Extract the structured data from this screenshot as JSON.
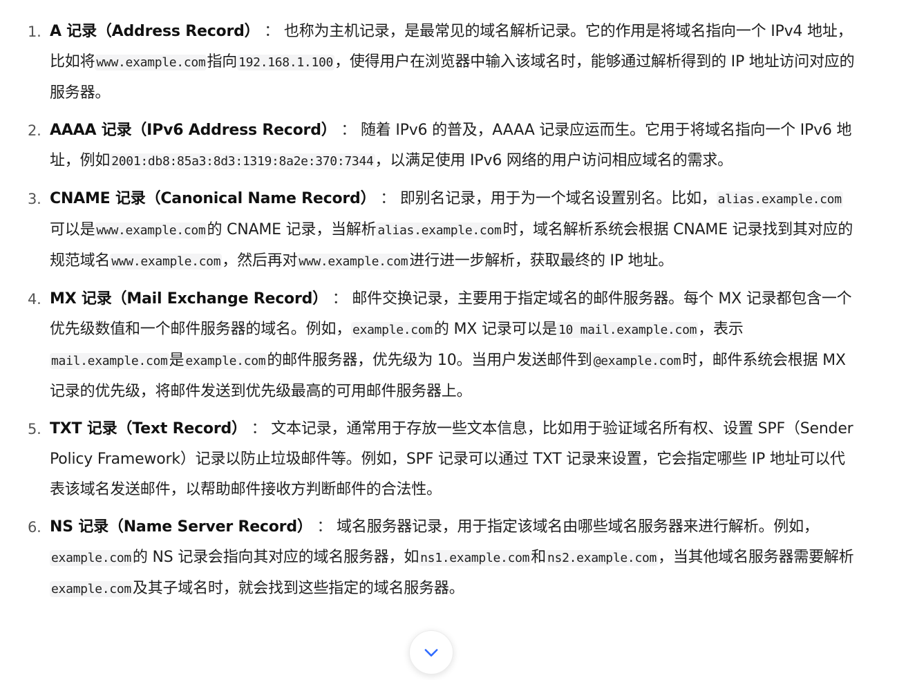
{
  "items": [
    {
      "number": "1.",
      "term": "A 记录（Address Record）",
      "colon": "：",
      "segments": [
        {
          "type": "text",
          "text": "也称为主机记录，是最常见的域名解析记录。它的作用是将域名指向一个 IPv4 地址，比如将"
        },
        {
          "type": "code",
          "text": "www.example.com"
        },
        {
          "type": "text",
          "text": "指向"
        },
        {
          "type": "code",
          "text": "192.168.1.100"
        },
        {
          "type": "text",
          "text": "，使得用户在浏览器中输入该域名时，能够通过解析得到的 IP 地址访问对应的服务器。"
        }
      ]
    },
    {
      "number": "2.",
      "term": "AAAA 记录（IPv6 Address Record）",
      "colon": "：",
      "segments": [
        {
          "type": "text",
          "text": "随着 IPv6 的普及，AAAA 记录应运而生。它用于将域名指向一个 IPv6 地址，例如"
        },
        {
          "type": "code",
          "text": "2001:db8:85a3:8d3:1319:8a2e:370:7344"
        },
        {
          "type": "text",
          "text": "，以满足使用 IPv6 网络的用户访问相应域名的需求。"
        }
      ]
    },
    {
      "number": "3.",
      "term": "CNAME 记录（Canonical Name Record）",
      "colon": "：",
      "segments": [
        {
          "type": "text",
          "text": "即别名记录，用于为一个域名设置别名。比如，"
        },
        {
          "type": "code",
          "text": "alias.example.com"
        },
        {
          "type": "text",
          "text": "可以是"
        },
        {
          "type": "code",
          "text": "www.example.com"
        },
        {
          "type": "text",
          "text": "的 CNAME 记录，当解析"
        },
        {
          "type": "code",
          "text": "alias.example.com"
        },
        {
          "type": "text",
          "text": "时，域名解析系统会根据 CNAME 记录找到其对应的规范域名"
        },
        {
          "type": "code",
          "text": "www.example.com"
        },
        {
          "type": "text",
          "text": "，然后再对"
        },
        {
          "type": "code",
          "text": "www.example.com"
        },
        {
          "type": "text",
          "text": "进行进一步解析，获取最终的 IP 地址。"
        }
      ]
    },
    {
      "number": "4.",
      "term": "MX 记录（Mail Exchange Record）",
      "colon": "：",
      "segments": [
        {
          "type": "text",
          "text": "邮件交换记录，主要用于指定域名的邮件服务器。每个 MX 记录都包含一个优先级数值和一个邮件服务器的域名。例如，"
        },
        {
          "type": "code",
          "text": "example.com"
        },
        {
          "type": "text",
          "text": "的 MX 记录可以是"
        },
        {
          "type": "code",
          "text": "10 mail.example.com"
        },
        {
          "type": "text",
          "text": "，表示"
        },
        {
          "type": "code",
          "text": "mail.example.com"
        },
        {
          "type": "text",
          "text": "是"
        },
        {
          "type": "code",
          "text": "example.com"
        },
        {
          "type": "text",
          "text": "的邮件服务器，优先级为 10。当用户发送邮件到"
        },
        {
          "type": "code",
          "text": "@example.com"
        },
        {
          "type": "text",
          "text": "时，邮件系统会根据 MX 记录的优先级，将邮件发送到优先级最高的可用邮件服务器上。"
        }
      ]
    },
    {
      "number": "5.",
      "term": "TXT 记录（Text Record）",
      "colon": "：",
      "segments": [
        {
          "type": "text",
          "text": "文本记录，通常用于存放一些文本信息，比如用于验证域名所有权、设置 SPF（Sender Policy Framework）记录以防止垃圾邮件等。例如，SPF 记录可以通过 TXT 记录来设置，它会指定哪些 IP 地址可以代表该域名发送邮件，以帮助邮件接收方判断邮件的合法性。"
        }
      ]
    },
    {
      "number": "6.",
      "term": "NS 记录（Name Server Record）",
      "colon": "：",
      "segments": [
        {
          "type": "text",
          "text": "域名服务器记录，用于指定该域名由哪些域名服务器来进行解析。例如，"
        },
        {
          "type": "code",
          "text": "example.com"
        },
        {
          "type": "text",
          "text": "的 NS 记录会指向其对应的域名服务器，如"
        },
        {
          "type": "code",
          "text": "ns1.example.com"
        },
        {
          "type": "text",
          "text": "和"
        },
        {
          "type": "code",
          "text": "ns2.example.com"
        },
        {
          "type": "text",
          "text": "，当其他域名服务器需要解析"
        },
        {
          "type": "code",
          "text": "example.com"
        },
        {
          "type": "text",
          "text": "及其子域名时，就会找到这些指定的域名服务器。"
        }
      ]
    }
  ],
  "scroll_button": {
    "icon": "chevron-down-icon",
    "icon_color": "#2f6bff"
  }
}
